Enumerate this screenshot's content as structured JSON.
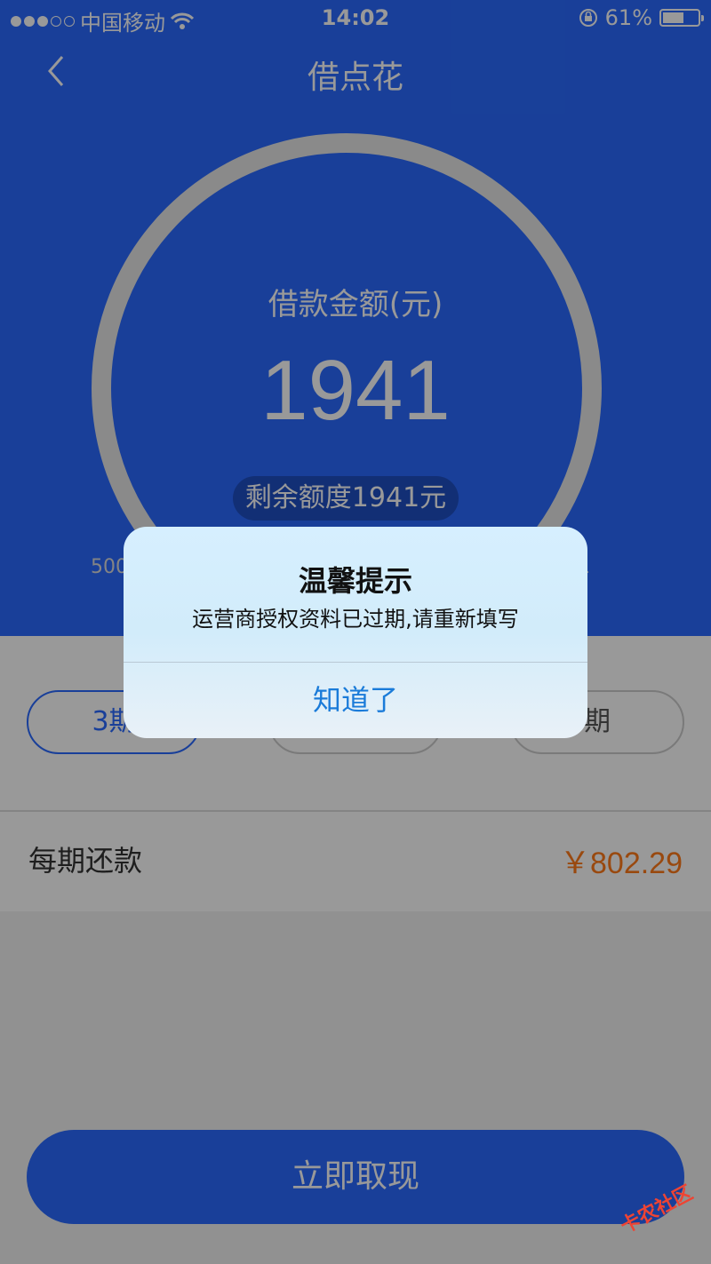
{
  "status": {
    "carrier": "中国移动",
    "time": "14:02",
    "battery": "61%",
    "battery_level": 0.61
  },
  "nav": {
    "title": "借点花"
  },
  "loan": {
    "amount_label": "借款金额(元)",
    "amount": "1941",
    "remaining": "剩余额度1941元",
    "min_label": "500",
    "max_label": "1"
  },
  "terms": [
    "3期",
    "",
    "期"
  ],
  "repay": {
    "label": "每期还款",
    "value": "￥802.29"
  },
  "action": {
    "label": "立即取现"
  },
  "alert": {
    "title": "温馨提示",
    "message": "运营商授权资料已过期,请重新填写",
    "button": "知道了"
  },
  "watermark": "卡农社区",
  "colors": {
    "primary": "#2a6aff",
    "accent": "#ff7a1a",
    "alert_button": "#1a7bd9"
  }
}
